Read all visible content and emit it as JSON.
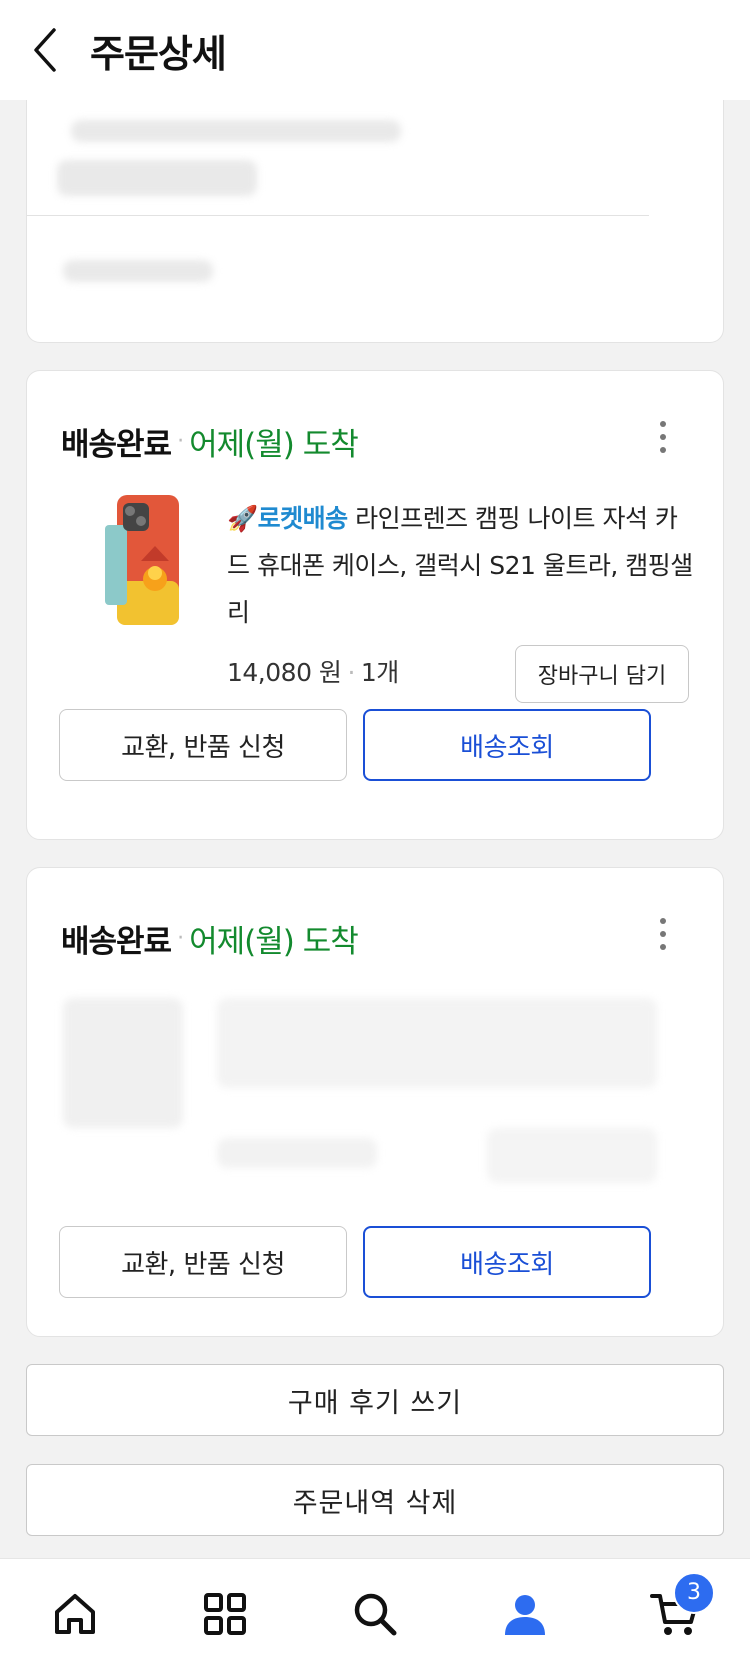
{
  "header": {
    "title": "주문상세"
  },
  "order1": {
    "status": "배송완료",
    "arrival": "어제(월) 도착",
    "badge": "로켓배송",
    "product_name": "라인프렌즈 캠핑 나이트 자석 카드 휴대폰 케이스, 갤럭시 S21 울트라, 캠핑샐리",
    "price": "14,080 원",
    "quantity": "1개",
    "cart_button": "장바구니 담기",
    "exchange_button": "교환, 반품 신청",
    "tracking_button": "배송조회"
  },
  "order2": {
    "status": "배송완료",
    "arrival": "어제(월) 도착",
    "exchange_button": "교환, 반품 신청",
    "tracking_button": "배송조회"
  },
  "actions": {
    "review_button": "구매 후기 쓰기",
    "delete_button": "주문내역 삭제"
  },
  "nav": {
    "items": [
      "home-icon",
      "category-icon",
      "search-icon",
      "my-page-icon",
      "cart-icon"
    ],
    "cart_count": "3",
    "active_color": "#2d6cf0"
  }
}
